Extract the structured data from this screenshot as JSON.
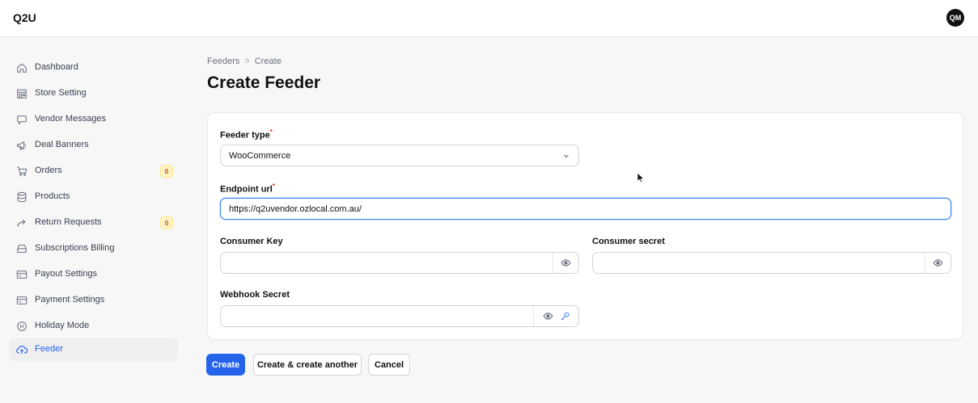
{
  "app": {
    "brand": "Q2U",
    "avatar_initials": "QM"
  },
  "sidebar": {
    "items": [
      {
        "label": "Dashboard",
        "icon": "home-icon"
      },
      {
        "label": "Store Setting",
        "icon": "store-icon"
      },
      {
        "label": "Vendor Messages",
        "icon": "message-icon"
      },
      {
        "label": "Deal Banners",
        "icon": "megaphone-icon"
      },
      {
        "label": "Orders",
        "icon": "cart-icon",
        "badge": "0"
      },
      {
        "label": "Products",
        "icon": "database-icon"
      },
      {
        "label": "Return Requests",
        "icon": "return-arrow-icon",
        "badge": "0"
      },
      {
        "label": "Subscriptions Billing",
        "icon": "inbox-icon"
      },
      {
        "label": "Payout Settings",
        "icon": "card-icon"
      },
      {
        "label": "Payment Settings",
        "icon": "card-icon"
      },
      {
        "label": "Holiday Mode",
        "icon": "pause-icon"
      },
      {
        "label": "Feeder",
        "icon": "cloud-upload-icon",
        "active": true
      }
    ]
  },
  "breadcrumb": {
    "parent": "Feeders",
    "separator": ">",
    "current": "Create"
  },
  "page_title": "Create Feeder",
  "form": {
    "feeder_type": {
      "label": "Feeder type",
      "required_mark": "*",
      "value": "WooCommerce"
    },
    "endpoint_url": {
      "label": "Endpoint url",
      "required_mark": "*",
      "value": "https://q2uvendor.ozlocal.com.au/"
    },
    "consumer_key": {
      "label": "Consumer Key",
      "value": ""
    },
    "consumer_secret": {
      "label": "Consumer secret",
      "value": ""
    },
    "webhook_secret": {
      "label": "Webhook Secret",
      "value": ""
    }
  },
  "actions": {
    "create": "Create",
    "create_another": "Create & create another",
    "cancel": "Cancel"
  },
  "colors": {
    "accent": "#2563eb",
    "badge_bg": "#fef3c7",
    "badge_text": "#b45309",
    "required": "#dc2626"
  }
}
